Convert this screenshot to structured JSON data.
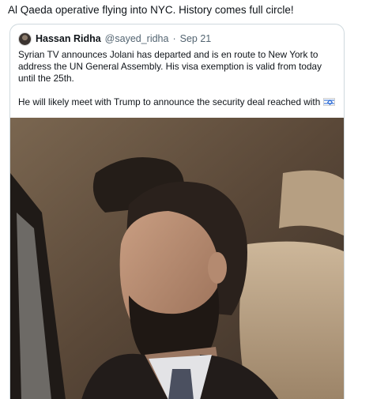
{
  "tweet": {
    "text": "Al Qaeda operative flying into NYC. History comes full circle!"
  },
  "quote": {
    "author_name": "Hassan Ridha",
    "author_handle": "@sayed_ridha",
    "separator": "·",
    "date": "Sep 21",
    "paragraph1": "Syrian TV announces Jolani has departed and is en route to New York to address the UN General Assembly. His visa exemption is valid from today until the 25th.",
    "paragraph2": "He will likely meet with Trump to announce the security deal reached with"
  },
  "icons": {
    "flag": "israel-flag-icon",
    "avatar": "profile-avatar"
  },
  "media": {
    "subject": "man in suit seated in car"
  }
}
